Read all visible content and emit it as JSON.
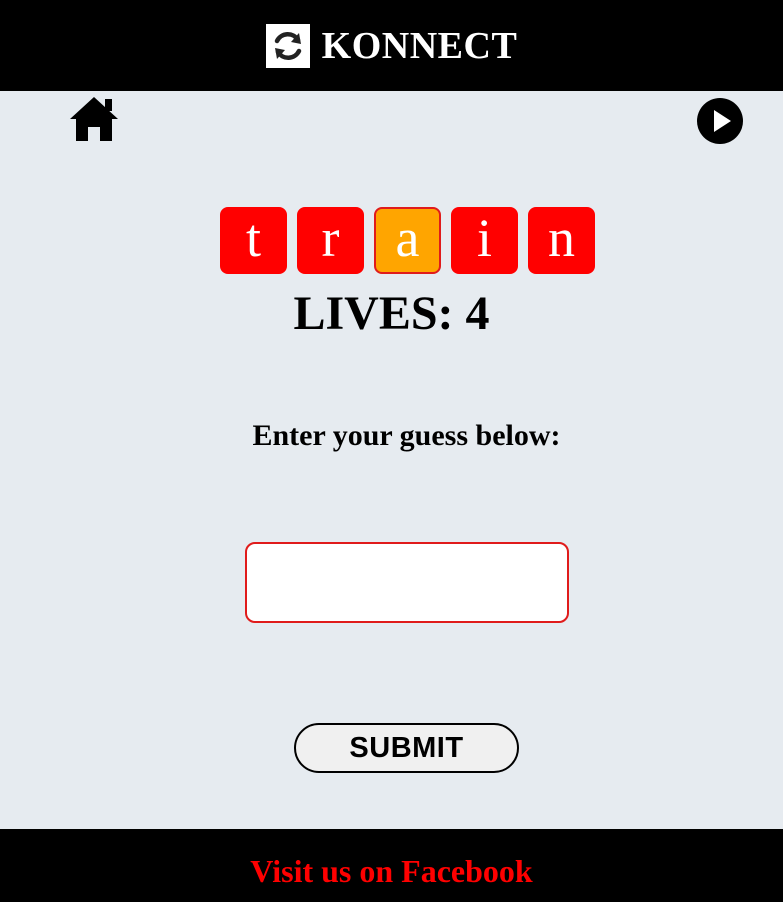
{
  "header": {
    "title": "KONNECT",
    "logo_icon": "refresh-cycle-icon"
  },
  "nav": {
    "home_icon": "home-icon",
    "play_icon": "play-icon"
  },
  "word": {
    "tiles": [
      {
        "letter": "t",
        "state": "wrong",
        "color": "#ff0000"
      },
      {
        "letter": "r",
        "state": "wrong",
        "color": "#ff0000"
      },
      {
        "letter": "a",
        "state": "partial",
        "color": "#ffa500"
      },
      {
        "letter": "i",
        "state": "wrong",
        "color": "#ff0000"
      },
      {
        "letter": "n",
        "state": "wrong",
        "color": "#ff0000"
      }
    ]
  },
  "lives": {
    "text": "LIVES: 4"
  },
  "guess": {
    "prompt": "Enter your guess below:",
    "value": "",
    "placeholder": "",
    "border_color": "#e01b1b"
  },
  "submit": {
    "label": "SUBMIT"
  },
  "footer": {
    "link_text": "Visit us on Facebook",
    "link_color": "#ff0000"
  },
  "colors": {
    "background": "#e6ebf0",
    "bar": "#000000"
  }
}
